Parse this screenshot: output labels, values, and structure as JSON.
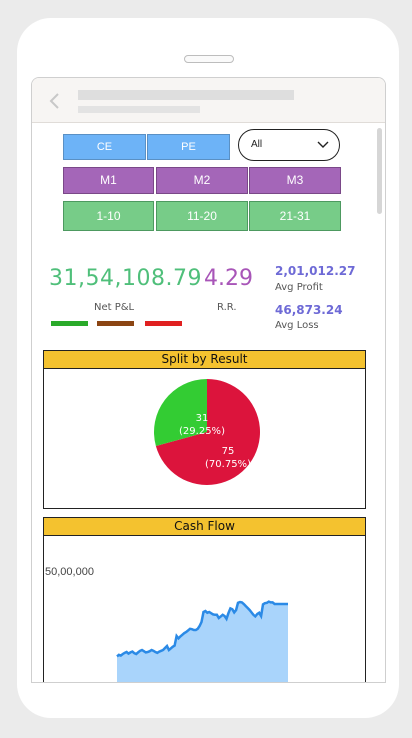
{
  "filters": {
    "option_buttons": [
      "CE",
      "PE"
    ],
    "dropdown": {
      "selected": "All"
    },
    "months": [
      "M1",
      "M2",
      "M3"
    ],
    "day_ranges": [
      "1-10",
      "11-20",
      "21-31"
    ]
  },
  "kpis": {
    "net_pl": {
      "value": "31,54,108.79",
      "label": "Net P&L",
      "color": "#4fbf7a"
    },
    "rr": {
      "value": "4.29",
      "label": "R.R.",
      "color": "#a855b8"
    },
    "avg_profit": {
      "value": "2,01,012.27",
      "label": "Avg Profit"
    },
    "avg_loss": {
      "value": "46,873.24",
      "label": "Avg Loss"
    },
    "legend_colors": [
      "#2aaa2a",
      "#8b4513",
      "#e02020"
    ]
  },
  "split_by_result": {
    "title": "Split by Result",
    "chart_data": {
      "type": "pie",
      "slices": [
        {
          "value": 31,
          "percent": "29.25%",
          "color": "#33cc33"
        },
        {
          "value": 75,
          "percent": "70.75%",
          "color": "#dc143c"
        }
      ]
    },
    "labels": {
      "win": {
        "count": "31",
        "pct": "(29.25%)"
      },
      "loss": {
        "count": "75",
        "pct": "(70.75%)"
      }
    }
  },
  "cash_flow": {
    "title": "Cash Flow",
    "tick_label": "50,00,000",
    "chart_data": {
      "type": "area",
      "y_tick": 5000000,
      "values": [
        0,
        0,
        0,
        0,
        0,
        0,
        0,
        0,
        0,
        0,
        0,
        0,
        0,
        0,
        0,
        0,
        0,
        0,
        0,
        0,
        680000,
        760000,
        720000,
        800000,
        860000,
        900000,
        820000,
        880000,
        920000,
        840000,
        800000,
        880000,
        960000,
        1000000,
        940000,
        880000,
        900000,
        940000,
        1000000,
        960000,
        900000,
        860000,
        920000,
        960000,
        1000000,
        1100000,
        1200000,
        1000000,
        1080000,
        1160000,
        1220000,
        1700000,
        1580000,
        1680000,
        1760000,
        1840000,
        1900000,
        1980000,
        2060000,
        2040000,
        2000000,
        2000000,
        2060000,
        2200000,
        2400000,
        2900000,
        2950000,
        2860000,
        2900000,
        2840000,
        2780000,
        2760000,
        2760000,
        2600000,
        2680000,
        2760000,
        2700000,
        2560000,
        2840000,
        3080000,
        3040000,
        2880000,
        3000000,
        3360000,
        3400000,
        3380000,
        3300000,
        3200000,
        3100000,
        3000000,
        2880000,
        2760000,
        2680000,
        2800000,
        2860000,
        2700000,
        3280000,
        3340000,
        3360000,
        3420000,
        3380000,
        3380000,
        3300000,
        3300000,
        3300000,
        3300000,
        3300000,
        3300000,
        3300000,
        3300000
      ]
    }
  }
}
